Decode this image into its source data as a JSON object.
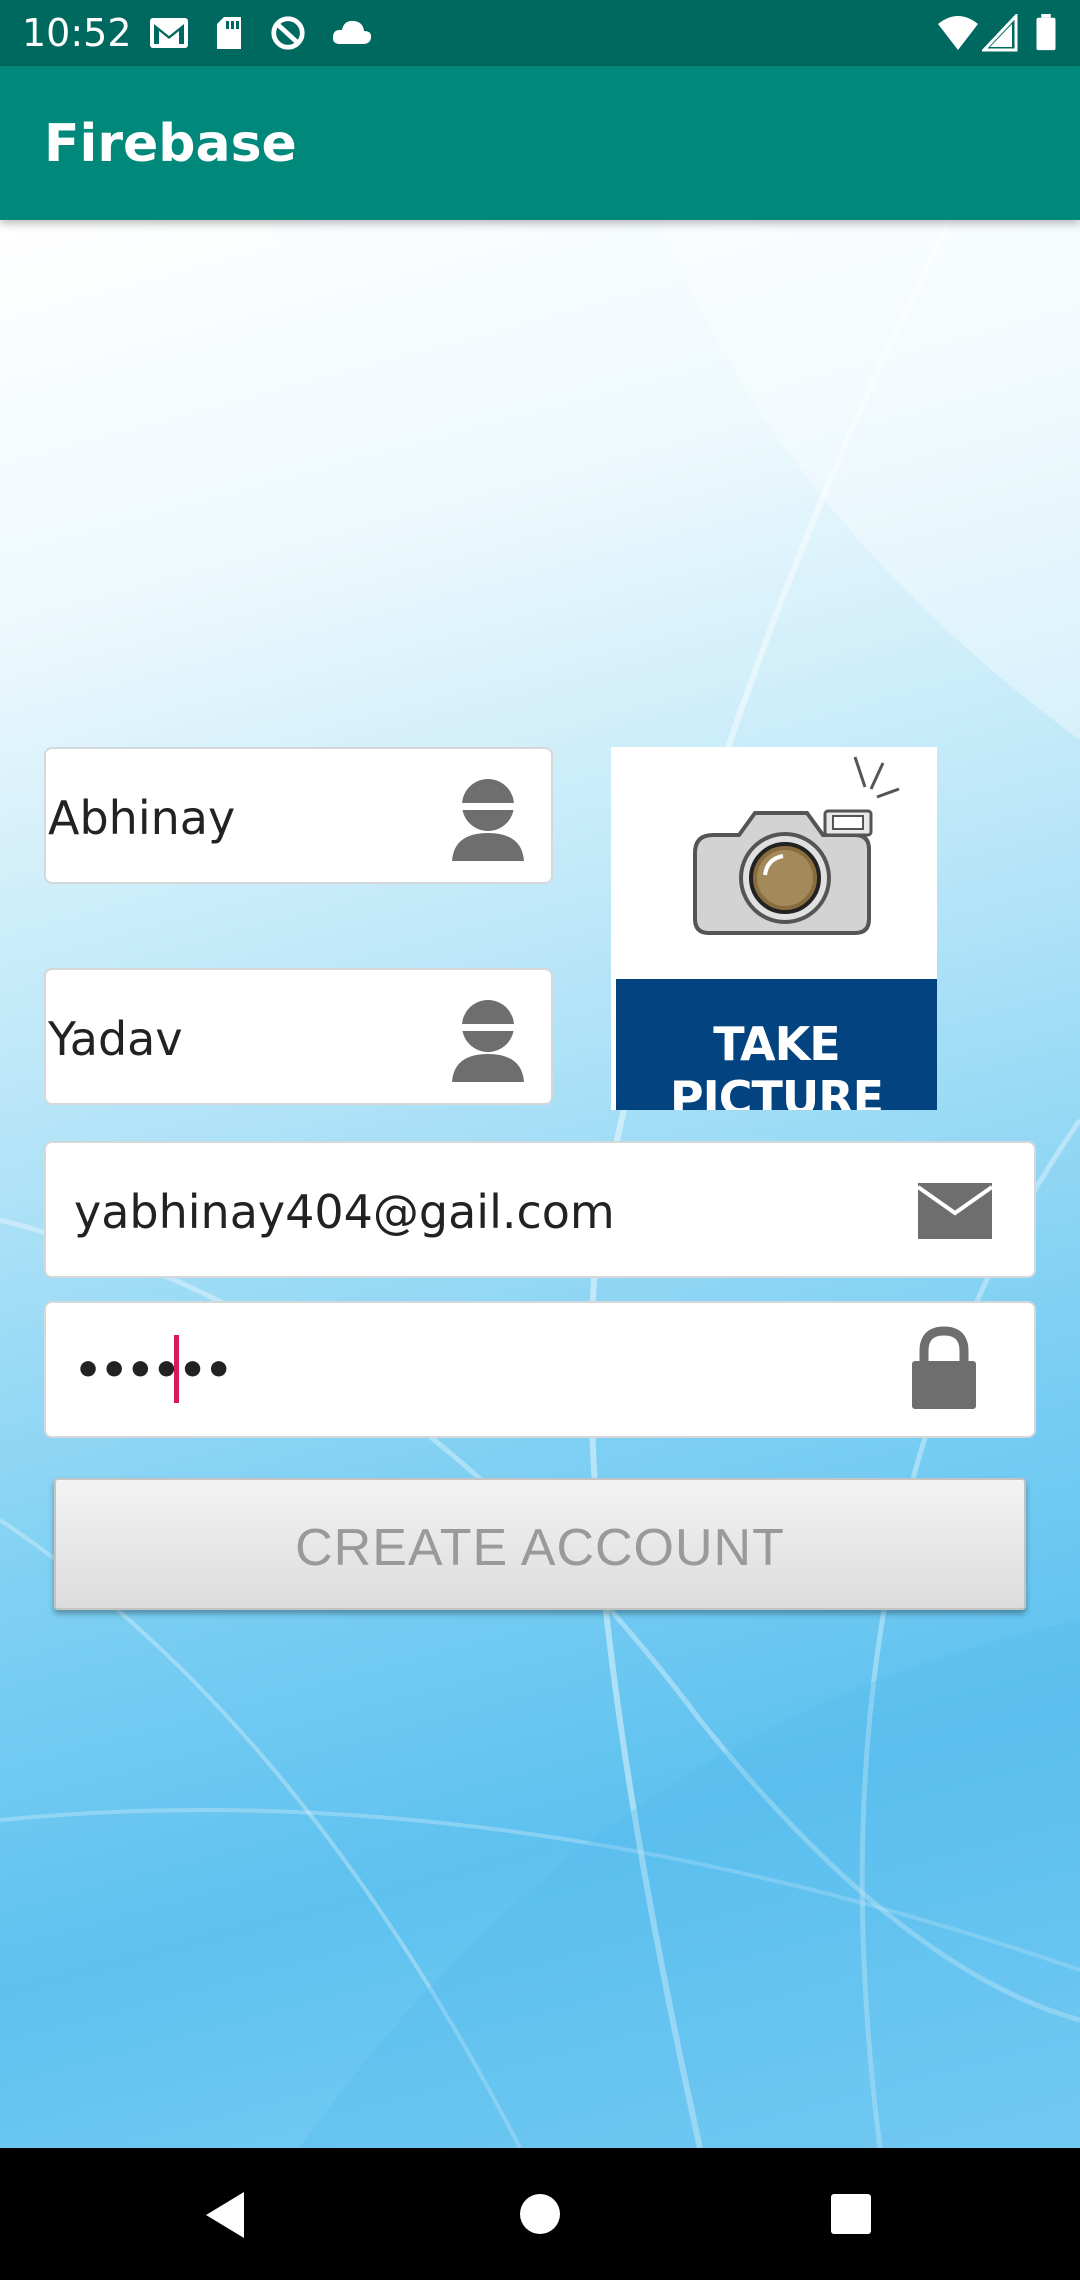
{
  "status_bar": {
    "time": "10:52",
    "left_icons": [
      "gmail-icon",
      "sd-card-icon",
      "data-saver-icon",
      "cloud-icon"
    ],
    "right_icons": [
      "wifi-icon",
      "cell-signal-icon",
      "battery-icon"
    ]
  },
  "app_bar": {
    "title": "Firebase",
    "color": "#00897b"
  },
  "form": {
    "first_name": {
      "value": "Abhinay",
      "icon": "person-icon"
    },
    "last_name": {
      "value": "Yadav",
      "icon": "person-icon"
    },
    "email": {
      "value": "yabhinay404@gail.com",
      "icon": "mail-icon"
    },
    "password": {
      "value": "••••••",
      "icon": "lock-icon"
    },
    "take_picture": {
      "label": "TAKE PICTURE",
      "icon": "camera-icon"
    },
    "create_account_label": "CREATE ACCOUNT"
  },
  "nav_bar": {
    "buttons": [
      "back-icon",
      "home-icon",
      "recents-icon"
    ]
  },
  "colors": {
    "status_bar": "#00695f",
    "app_bar": "#00897b",
    "caret": "#d81b60",
    "take_picture_band": "#03437f"
  }
}
